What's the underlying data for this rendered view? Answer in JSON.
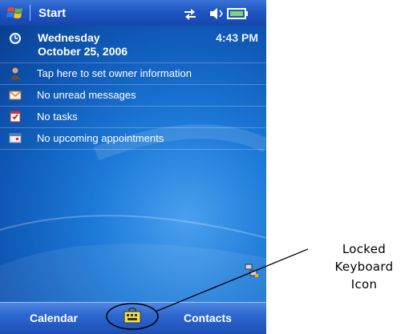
{
  "titlebar": {
    "title": "Start"
  },
  "today": {
    "day": "Wednesday",
    "date": "October 25, 2006",
    "time": "4:43 PM",
    "items": [
      {
        "label": "Tap here to set owner information",
        "icon": "owner-icon"
      },
      {
        "label": "No unread messages",
        "icon": "envelope-icon"
      },
      {
        "label": "No tasks",
        "icon": "task-icon"
      },
      {
        "label": "No upcoming appointments",
        "icon": "calendar-icon"
      }
    ]
  },
  "softkeys": {
    "left": "Calendar",
    "right": "Contacts"
  },
  "callout": {
    "line1": "Locked Keyboard",
    "line2": "Icon"
  },
  "colors": {
    "titlebar": "#1f56c4",
    "background": "#1d7ad8",
    "softbar": "#2c66cf"
  }
}
